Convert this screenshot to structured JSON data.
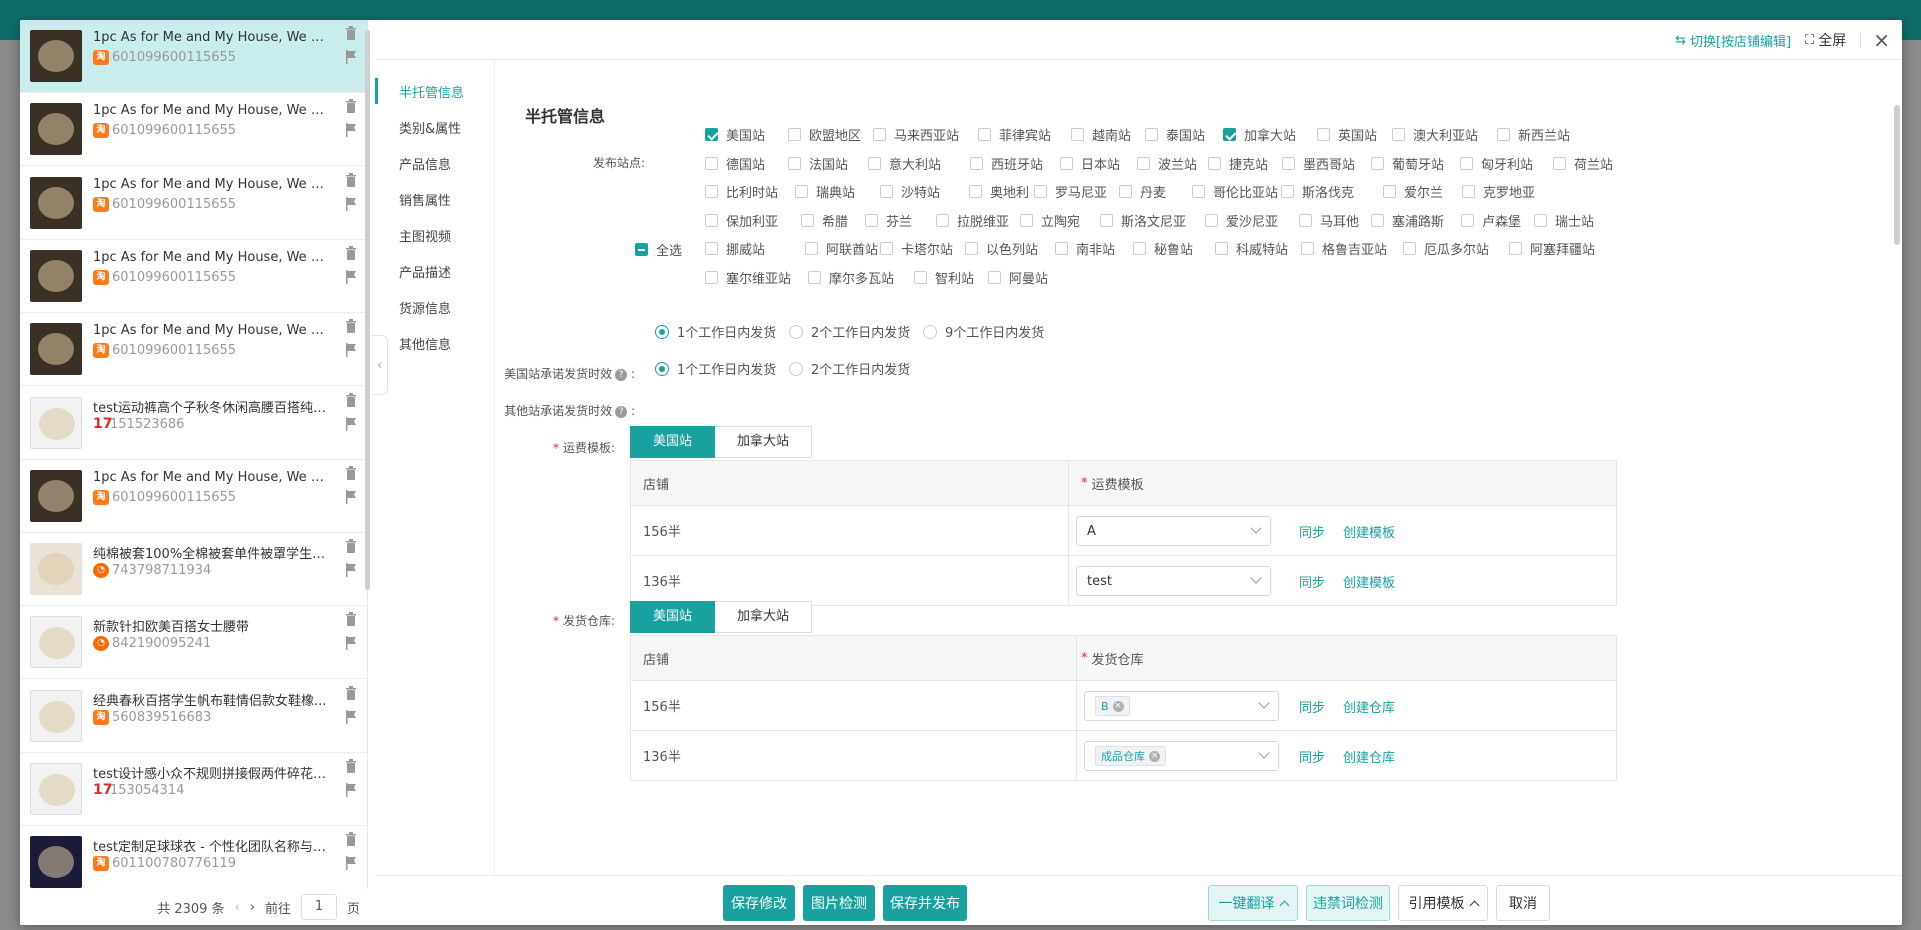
{
  "header": {
    "switch_label": "切换[按店铺编辑]",
    "fullscreen_label": "全屏",
    "close_glyph": "×"
  },
  "product_list": {
    "items": [
      {
        "title": "1pc As for Me and My House, We Wi...",
        "id": "601099600115655",
        "platform": "taobao",
        "thumb": "sign"
      },
      {
        "title": "1pc As for Me and My House, We Wi...",
        "id": "601099600115655",
        "platform": "taobao",
        "thumb": "sign"
      },
      {
        "title": "1pc As for Me and My House, We Wi...",
        "id": "601099600115655",
        "platform": "taobao",
        "thumb": "sign"
      },
      {
        "title": "1pc As for Me and My House, We Wi...",
        "id": "601099600115655",
        "platform": "taobao",
        "thumb": "sign"
      },
      {
        "title": "1pc As for Me and My House, We Wi...",
        "id": "601099600115655",
        "platform": "taobao",
        "thumb": "sign"
      },
      {
        "title": "test运动裤高个子秋冬休闲高腰百搭纯色...",
        "id": "151523686",
        "platform": "17",
        "thumb": "pants"
      },
      {
        "title": "1pc As for Me and My House, We Wi...",
        "id": "601099600115655",
        "platform": "taobao",
        "thumb": "sign"
      },
      {
        "title": "纯棉被套100%全棉被套单件被罩学生宿...",
        "id": "743798711934",
        "platform": "1688",
        "thumb": "bedding"
      },
      {
        "title": "新款针扣欧美百搭女士腰带",
        "id": "842190095241",
        "platform": "1688",
        "thumb": "belt"
      },
      {
        "title": "经典春秋百搭学生帆布鞋情侣款女鞋橡...",
        "id": "560839516683",
        "platform": "taobao",
        "thumb": "shoes"
      },
      {
        "title": "test设计感小众不规则拼接假两件碎花吊...",
        "id": "153054314",
        "platform": "17",
        "thumb": "dress"
      },
      {
        "title": "test定制足球球衣 - 个性化团队名称与号...",
        "id": "601100780776119",
        "platform": "taobao",
        "thumb": "jersey"
      }
    ],
    "pager": {
      "total": "共 2309 条",
      "goto": "前往",
      "page": "1",
      "page_unit": "页"
    }
  },
  "section_nav": [
    "半托管信息",
    "类别&属性",
    "产品信息",
    "销售属性",
    "主图视频",
    "产品描述",
    "货源信息",
    "其他信息"
  ],
  "main": {
    "title": "半托管信息",
    "site_label": "发布站点:",
    "select_all": "全选",
    "sites": [
      {
        "name": "美国站",
        "checked": true
      },
      {
        "name": "欧盟地区",
        "checked": false
      },
      {
        "name": "马来西亚站",
        "checked": false
      },
      {
        "name": "菲律宾站",
        "checked": false
      },
      {
        "name": "越南站",
        "checked": false
      },
      {
        "name": "泰国站",
        "checked": false
      },
      {
        "name": "加拿大站",
        "checked": true
      },
      {
        "name": "英国站",
        "checked": false
      },
      {
        "name": "澳大利亚站",
        "checked": false
      },
      {
        "name": "新西兰站",
        "checked": false
      },
      {
        "name": "德国站",
        "checked": false
      },
      {
        "name": "法国站",
        "checked": false
      },
      {
        "name": "意大利站",
        "checked": false
      },
      {
        "name": "西班牙站",
        "checked": false
      },
      {
        "name": "日本站",
        "checked": false
      },
      {
        "name": "波兰站",
        "checked": false
      },
      {
        "name": "捷克站",
        "checked": false
      },
      {
        "name": "墨西哥站",
        "checked": false
      },
      {
        "name": "葡萄牙站",
        "checked": false
      },
      {
        "name": "匈牙利站",
        "checked": false
      },
      {
        "name": "荷兰站",
        "checked": false
      },
      {
        "name": "比利时站",
        "checked": false
      },
      {
        "name": "瑞典站",
        "checked": false
      },
      {
        "name": "沙特站",
        "checked": false
      },
      {
        "name": "奥地利",
        "checked": false
      },
      {
        "name": "罗马尼亚",
        "checked": false
      },
      {
        "name": "丹麦",
        "checked": false
      },
      {
        "name": "哥伦比亚站",
        "checked": false
      },
      {
        "name": "斯洛伐克",
        "checked": false
      },
      {
        "name": "爱尔兰",
        "checked": false
      },
      {
        "name": "克罗地亚",
        "checked": false
      },
      {
        "name": "保加利亚",
        "checked": false
      },
      {
        "name": "希腊",
        "checked": false
      },
      {
        "name": "芬兰",
        "checked": false
      },
      {
        "name": "拉脱维亚",
        "checked": false
      },
      {
        "name": "立陶宛",
        "checked": false
      },
      {
        "name": "斯洛文尼亚",
        "checked": false
      },
      {
        "name": "爱沙尼亚",
        "checked": false
      },
      {
        "name": "马耳他",
        "checked": false
      },
      {
        "name": "塞浦路斯",
        "checked": false
      },
      {
        "name": "卢森堡",
        "checked": false
      },
      {
        "name": "瑞士站",
        "checked": false
      },
      {
        "name": "挪威站",
        "checked": false
      },
      {
        "name": "阿联酋站",
        "checked": false
      },
      {
        "name": "卡塔尔站",
        "checked": false
      },
      {
        "name": "以色列站",
        "checked": false
      },
      {
        "name": "南非站",
        "checked": false
      },
      {
        "name": "秘鲁站",
        "checked": false
      },
      {
        "name": "科威特站",
        "checked": false
      },
      {
        "name": "格鲁吉亚站",
        "checked": false
      },
      {
        "name": "厄瓜多尔站",
        "checked": false
      },
      {
        "name": "阿塞拜疆站",
        "checked": false
      },
      {
        "name": "塞尔维亚站",
        "checked": false
      },
      {
        "name": "摩尔多瓦站",
        "checked": false
      },
      {
        "name": "智利站",
        "checked": false
      },
      {
        "name": "阿曼站",
        "checked": false
      }
    ],
    "us_ship_label": "美国站承诺发货时效",
    "us_ship_options": [
      {
        "label": "1个工作日内发货",
        "selected": true
      },
      {
        "label": "2个工作日内发货",
        "selected": false
      },
      {
        "label": "9个工作日内发货",
        "selected": false
      }
    ],
    "other_ship_label": "其他站承诺发货时效",
    "other_ship_options": [
      {
        "label": "1个工作日内发货",
        "selected": true
      },
      {
        "label": "2个工作日内发货",
        "selected": false
      }
    ],
    "freight": {
      "label": "运费模板:",
      "tabs": [
        "美国站",
        "加拿大站"
      ],
      "col_shop": "店铺",
      "col_value": "运费模板",
      "rows": [
        {
          "shop": "156半",
          "value": "A",
          "sync": "同步",
          "create": "创建模板"
        },
        {
          "shop": "136半",
          "value": "test",
          "sync": "同步",
          "create": "创建模板"
        }
      ]
    },
    "warehouse": {
      "label": "发货仓库:",
      "tabs": [
        "美国站",
        "加拿大站"
      ],
      "col_shop": "店铺",
      "col_value": "发货仓库",
      "rows": [
        {
          "shop": "156半",
          "tag": "B",
          "sync": "同步",
          "create": "创建仓库"
        },
        {
          "shop": "136半",
          "tag": "成品仓库",
          "sync": "同步",
          "create": "创建仓库"
        }
      ]
    }
  },
  "footer": {
    "save": "保存修改",
    "image_check": "图片检测",
    "save_publish": "保存并发布",
    "translate": "一键翻译",
    "banned_check": "违禁词检测",
    "template": "引用模板",
    "cancel": "取消"
  },
  "colors": {
    "accent": "#17a2a0",
    "active_row": "#c9eded",
    "required": "#f5222d"
  }
}
